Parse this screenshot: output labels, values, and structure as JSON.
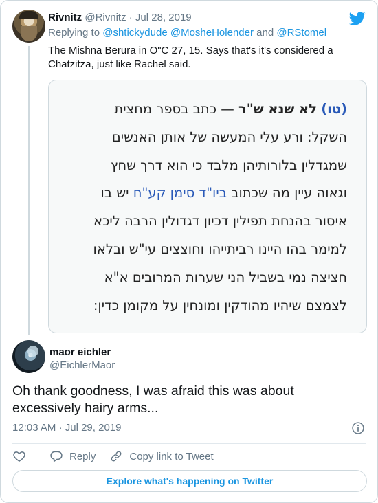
{
  "parent_tweet": {
    "author_name": "Rivnitz",
    "author_handle": "@Rivnitz",
    "separator": "·",
    "date": "Jul 28, 2019",
    "replying_to_prefix": "Replying to",
    "mentions": [
      "@shtickydude",
      "@MosheHolender",
      "@RStomel"
    ],
    "mention_joiner": "and",
    "text_line1": "The Mishna Berura in O\"C 27, 15. Says that's it's considered a",
    "text_line2": "Chatzitza, just like Rachel said.",
    "image_text": {
      "line1_marker": "(טו)",
      "line1_bold": "לא שנא ש\"ר",
      "line1_rest": "— כתב בספר מחצית",
      "line2": "השקל: ורע עלי המעשה של אותן האנשים",
      "line3": "שמגדלין בלורותיהן מלבד כי הוא דרך שחץ",
      "line4_start": "וגאוה עיין מה שכתוב",
      "line4_ref": "ביו\"ד סימן קע\"ח",
      "line4_end": "יש בו",
      "line5": "איסור בהנחת תפילין דכיון דגדולין הרבה ליכא",
      "line6": "למימר בהו היינו רביתייהו וחוצצים עי\"ש ובלאו",
      "line7": "חציצה נמי בשביל הני שערות המרובים א\"א",
      "line8": "לצמצם שיהיו מהודקין ומונחין על מקומן כדין:"
    }
  },
  "main_tweet": {
    "author_name": "maor eichler",
    "author_handle": "@EichlerMaor",
    "text_line1": "Oh thank goodness, I was afraid this was about",
    "text_line2": "excessively hairy arms...",
    "time": "12:03 AM",
    "separator": "·",
    "date": "Jul 29, 2019"
  },
  "actions": {
    "reply_label": "Reply",
    "copy_link_label": "Copy link to Tweet"
  },
  "explore_label": "Explore what's happening on Twitter",
  "icons": {
    "brand": "twitter-bird-icon",
    "like": "heart-icon",
    "reply": "speech-bubble-icon",
    "copy": "link-icon",
    "info": "info-icon"
  },
  "colors": {
    "accent": "#1b95e0",
    "secondary_text": "#657786",
    "border": "#cfd9de",
    "hebrew_reference": "#2a5ab8"
  }
}
